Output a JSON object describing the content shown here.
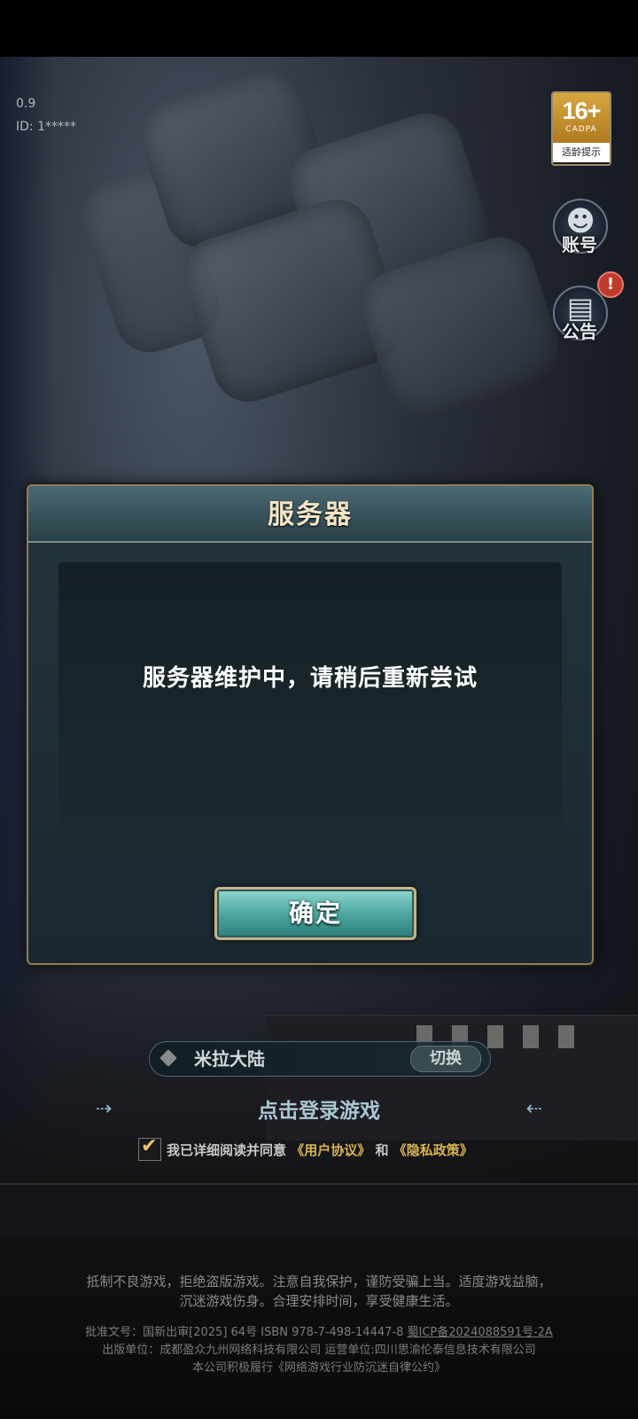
{
  "build_info": {
    "version": "0.9",
    "id": "ID: 1*****"
  },
  "age_rating": {
    "age": "16+",
    "org": "CADPA",
    "label": "适龄提示"
  },
  "side_buttons": {
    "account_label": "账号",
    "notice_label": "公告",
    "notice_alert": "!"
  },
  "dialog": {
    "title": "服务器",
    "message": "服务器维护中，请稍后重新尝试",
    "confirm_label": "确定"
  },
  "server": {
    "name": "米拉大陆",
    "switch_label": "切换"
  },
  "login": {
    "prompt": "点击登录游戏"
  },
  "agreement": {
    "text": "我已详细阅读并同意",
    "user_agreement": "《用户协议》",
    "conjunction": "和",
    "privacy_policy": "《隐私政策》",
    "checked": true
  },
  "footer": {
    "notice_line1": "抵制不良游戏，拒绝盗版游戏。注意自我保护，谨防受骗上当。适度游戏益脑，",
    "notice_line2": "沉迷游戏伤身。合理安排时间，享受健康生活。",
    "approval": "批准文号：国新出审[2025] 64号 ISBN 978-7-498-14447-8",
    "icp": "蜀ICP备2024088591号-2A",
    "publisher": "出版单位：成都盈众九州网络科技有限公司 运营单位:四川思渝伦泰信息技术有限公司",
    "pledge": "本公司积极履行《网络游戏行业防沉迷自律公约》"
  },
  "colors": {
    "dialog_border": "#8f7c58",
    "confirm_button": "#4aa39e",
    "link_gold": "#d9b455",
    "age_badge": "#d8a640",
    "alert_red": "#c0392b"
  }
}
